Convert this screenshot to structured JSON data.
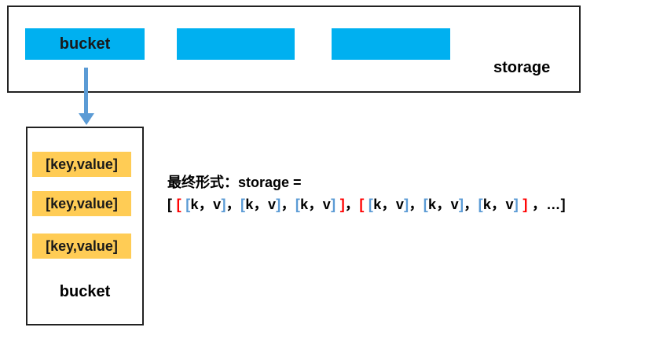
{
  "storage": {
    "label": "storage",
    "buckets": [
      "bucket",
      "",
      ""
    ],
    "color": "#00b0f0"
  },
  "bucket": {
    "entries": [
      "[key,value]",
      "[key,value]",
      "[key,value]"
    ],
    "label": "bucket",
    "entry_color": "#ffcc55"
  },
  "final_form": {
    "title": "最终形式：storage =",
    "tokens": [
      {
        "t": "[ ",
        "c": ""
      },
      {
        "t": "[ ",
        "c": "r"
      },
      {
        "t": "[",
        "c": "b"
      },
      {
        "t": "k，v",
        "c": ""
      },
      {
        "t": "]",
        "c": "b"
      },
      {
        "t": "，",
        "c": ""
      },
      {
        "t": "[",
        "c": "b"
      },
      {
        "t": "k，v",
        "c": ""
      },
      {
        "t": "]",
        "c": "b"
      },
      {
        "t": "，",
        "c": ""
      },
      {
        "t": "[",
        "c": "b"
      },
      {
        "t": "k，v",
        "c": ""
      },
      {
        "t": "]",
        "c": "b"
      },
      {
        "t": " ]",
        "c": "r"
      },
      {
        "t": "，",
        "c": ""
      },
      {
        "t": "[ ",
        "c": "r"
      },
      {
        "t": "[",
        "c": "b"
      },
      {
        "t": "k，v",
        "c": ""
      },
      {
        "t": "]",
        "c": "b"
      },
      {
        "t": "，",
        "c": ""
      },
      {
        "t": "[",
        "c": "b"
      },
      {
        "t": "k，v",
        "c": ""
      },
      {
        "t": "]",
        "c": "b"
      },
      {
        "t": "，",
        "c": ""
      },
      {
        "t": "[",
        "c": "b"
      },
      {
        "t": "k，v",
        "c": ""
      },
      {
        "t": "]",
        "c": "b"
      },
      {
        "t": " ]",
        "c": "r"
      },
      {
        "t": " ，…]",
        "c": ""
      }
    ],
    "colors": {
      "red": "#ff0000",
      "blue": "#5b9bd5"
    }
  }
}
